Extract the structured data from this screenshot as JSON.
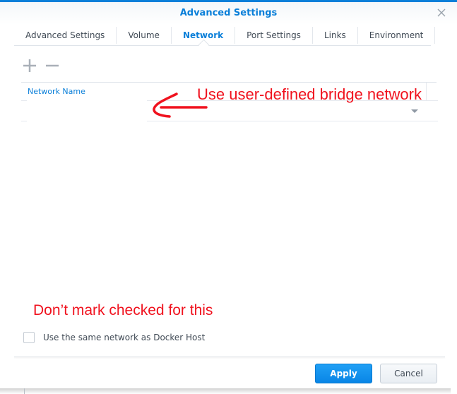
{
  "window": {
    "title": "Advanced Settings",
    "accent_color": "#0a7fd9",
    "close_icon": "close-icon"
  },
  "tabs": [
    {
      "label": "Advanced Settings",
      "active": false
    },
    {
      "label": "Volume",
      "active": false
    },
    {
      "label": "Network",
      "active": true
    },
    {
      "label": "Port Settings",
      "active": false
    },
    {
      "label": "Links",
      "active": false
    },
    {
      "label": "Environment",
      "active": false
    }
  ],
  "toolbar": {
    "add_icon": "plus-icon",
    "remove_icon": "minus-icon"
  },
  "table": {
    "columns": [
      "Network Name"
    ],
    "rows": [
      {
        "network_name": ""
      }
    ]
  },
  "annotations": {
    "top": "Use user-defined bridge network",
    "bottom": "Don’t mark checked for this",
    "color": "#f0121e"
  },
  "options": {
    "same_network_label": "Use the same network as Docker Host",
    "same_network_checked": false
  },
  "footer": {
    "apply_label": "Apply",
    "cancel_label": "Cancel"
  }
}
